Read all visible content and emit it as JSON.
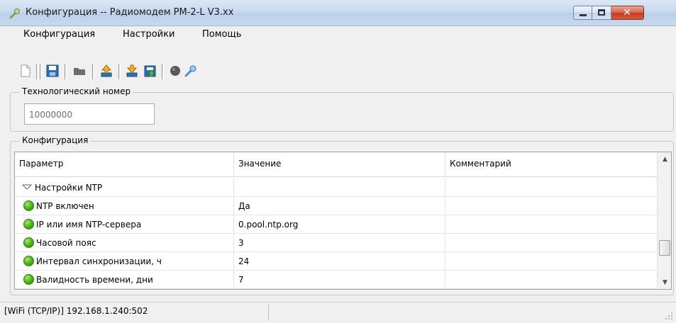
{
  "window": {
    "title": "Конфигурация -- Радиомодем РМ-2-L V3.xx",
    "close_glyph": "✕"
  },
  "menu": {
    "items": [
      "Конфигурация",
      "Настройки",
      "Помощь"
    ]
  },
  "toolbar": {
    "icons": [
      "new-file-icon",
      "save-icon",
      "folder-icon",
      "upload-icon",
      "download-icon",
      "import-icon",
      "record-icon",
      "connect-icon"
    ]
  },
  "tech_number": {
    "label": "Технологический номер",
    "value": "10000000"
  },
  "config": {
    "label": "Конфигурация",
    "columns": [
      "Параметр",
      "Значение",
      "Комментарий"
    ],
    "group_row": "Настройки NTP",
    "rows": [
      {
        "param": "NTP включен",
        "value": "Да",
        "comment": ""
      },
      {
        "param": "IP или имя NTP-сервера",
        "value": "0.pool.ntp.org",
        "comment": ""
      },
      {
        "param": "Часовой пояс",
        "value": "3",
        "comment": ""
      },
      {
        "param": "Интервал синхронизации, ч",
        "value": "24",
        "comment": ""
      },
      {
        "param": "Валидность времени, дни",
        "value": "7",
        "comment": ""
      }
    ]
  },
  "status": {
    "connection": "[WiFi (TCP/IP)] 192.168.1.240:502"
  },
  "colors": {
    "titlebar": "#c8d9ee",
    "close_button": "#c23b23",
    "status_dot": "#4cb51a"
  }
}
